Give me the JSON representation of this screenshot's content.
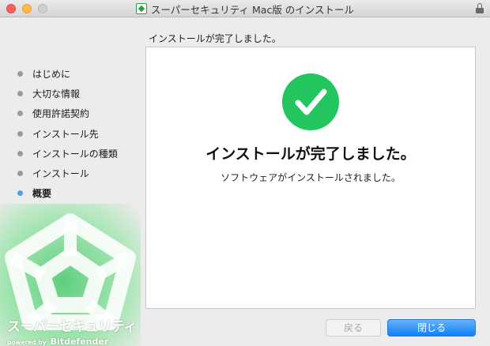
{
  "window": {
    "title": "スーパーセキュリティ Mac版 のインストール"
  },
  "sidebar": {
    "steps": [
      {
        "label": "はじめに"
      },
      {
        "label": "大切な情報"
      },
      {
        "label": "使用許諾契約"
      },
      {
        "label": "インストール先"
      },
      {
        "label": "インストールの種類"
      },
      {
        "label": "インストール"
      },
      {
        "label": "概要"
      }
    ],
    "active_step": "概要",
    "brand": {
      "name": "スーパーセキュリティ",
      "powered_by": "powered by",
      "partner": "Bitdefender"
    }
  },
  "main": {
    "header": "インストールが完了しました。",
    "success_icon": "checkmark-circle-icon",
    "title": "インストールが完了しました。",
    "message": "ソフトウェアがインストールされました。"
  },
  "buttons": {
    "back": "戻る",
    "close": "閉じる"
  },
  "colors": {
    "success": "#22c55e",
    "accent": "#0d81fc",
    "active_dot": "#4f9ef0",
    "brand_green": "#2e9e43"
  }
}
